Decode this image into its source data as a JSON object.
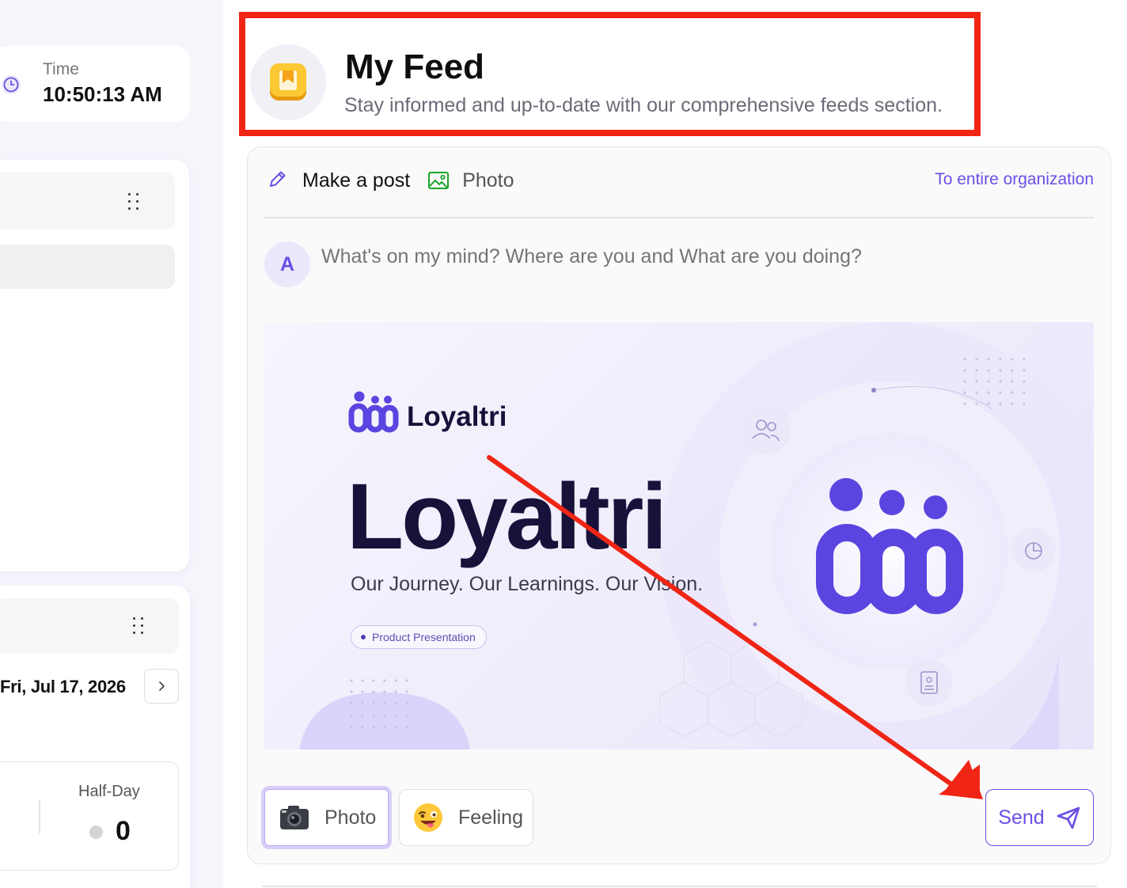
{
  "sidebar": {
    "time_card": {
      "label": "Time",
      "value": "10:50:13 AM"
    },
    "calendar_card": {
      "date": "Fri, Jul 17, 2026"
    },
    "summary": {
      "label": "Half-Day",
      "value": "0"
    }
  },
  "header": {
    "title": "My Feed",
    "subtitle": "Stay informed and up-to-date with our comprehensive feeds section."
  },
  "composer": {
    "make_post_label": "Make a post",
    "photo_tab_label": "Photo",
    "audience_label": "To entire organization",
    "avatar_initial": "A",
    "placeholder": "What's on my mind? Where are you and What are you doing?",
    "attachment": {
      "brand_name": "Loyaltri",
      "headline": "Loyaltri",
      "tagline": "Our Journey. Our Learnings. Our Vision.",
      "pill": "Product Presentation"
    },
    "photo_button_label": "Photo",
    "feeling_button_label": "Feeling",
    "send_button_label": "Send"
  },
  "colors": {
    "accent": "#6c4ee6",
    "annotation": "#f02515",
    "brand_dark": "#16123a"
  },
  "icons": [
    "clock-icon",
    "drag-handle-icon",
    "chevron-right-icon",
    "bookmark-icon",
    "pencil-icon",
    "image-icon",
    "camera-icon",
    "emoji-icon",
    "send-icon",
    "users-icon",
    "pie-chart-icon",
    "document-icon"
  ]
}
